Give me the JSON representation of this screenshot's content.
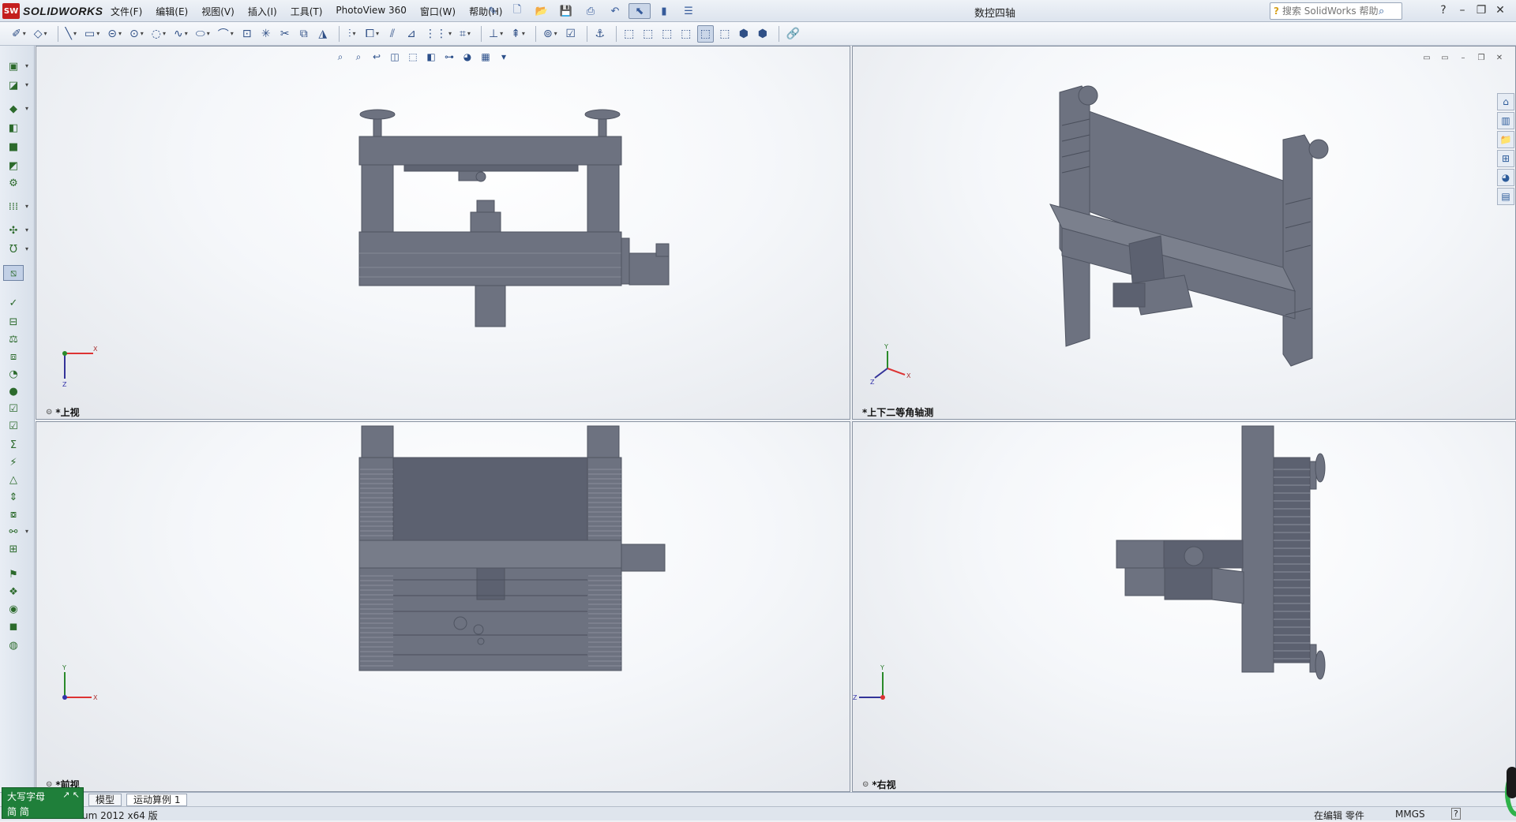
{
  "app": {
    "logo_text": "SOLIDWORKS",
    "logo_badge": "SW",
    "doc_title": "数控四轴"
  },
  "menus": [
    "文件(F)",
    "编辑(E)",
    "视图(V)",
    "插入(I)",
    "工具(T)",
    "PhotoView 360",
    "窗口(W)",
    "帮助(H)"
  ],
  "quick_access": [
    "pin-icon",
    "new-doc-icon",
    "open-icon",
    "save-icon",
    "print-icon",
    "undo-icon",
    "select-icon",
    "rebuild-icon",
    "options-icon"
  ],
  "search": {
    "placeholder": "搜索 SolidWorks 帮助"
  },
  "window_controls": [
    "help-icon",
    "minimize-icon",
    "restore-icon",
    "close-icon"
  ],
  "toolbar": [
    "sketch-icon",
    "smart-dim-icon",
    "line-icon",
    "rectangle-icon",
    "slot-icon",
    "circle-icon",
    "arc-icon",
    "spline-icon",
    "ellipse-icon",
    "fillet-icon",
    "point-icon",
    "centerline-icon",
    "trim-icon",
    "convert-icon",
    "offset-icon",
    "mirror-icon",
    "pattern-icon",
    "move-icon",
    "relations-icon",
    "repair-icon",
    "quick-snap-icon",
    "rapid-sketch-icon",
    "instant3d-icon",
    "normal-to-icon",
    "view-front-icon",
    "view-back-icon",
    "view-left-icon",
    "view-right-icon",
    "view-four-icon",
    "view-top-icon",
    "view-iso-icon",
    "view-bottom-icon",
    "link-icon"
  ],
  "left_tools": [
    "insert-component-icon",
    "mate-icon",
    "linear-pattern-icon",
    "smart-fastener-icon",
    "move-component-icon",
    "show-hidden-icon",
    "assembly-feature-icon",
    "reference-geometry-icon",
    "new-motion-icon",
    "bill-of-materials-icon",
    "exploded-view-icon",
    "spell-check-icon",
    "measure-icon",
    "mass-properties-icon",
    "section-properties-icon",
    "sensor-icon",
    "check-icon",
    "interference-icon",
    "clearance-icon",
    "hole-alignment-icon",
    "sum-icon",
    "simulation-icon",
    "draft-analysis-icon",
    "thickness-icon",
    "symmetry-icon",
    "compare-icon",
    "toolbox-icon",
    "design-check-icon",
    "appearance-icon",
    "render-icon",
    "photoview-icon"
  ],
  "viewports": {
    "top": {
      "label": "*上视"
    },
    "iso": {
      "label": "*上下二等角轴测"
    },
    "front": {
      "label": "*前视"
    },
    "right": {
      "label": "*右视"
    }
  },
  "view_hud": [
    "zoom-fit-icon",
    "zoom-area-icon",
    "previous-view-icon",
    "section-view-icon",
    "view-orientation-icon",
    "display-style-icon",
    "hide-show-icon",
    "appearance-icon",
    "scene-icon",
    "render-tools-icon"
  ],
  "viewport_controls": [
    "split-h-icon",
    "split-v-icon",
    "minimize-icon",
    "restore-icon",
    "close-icon"
  ],
  "task_pane": [
    "home-icon",
    "resources-icon",
    "design-library-icon",
    "file-explorer-icon",
    "appearance-scene-icon",
    "custom-props-icon"
  ],
  "axes": {
    "x": "X",
    "y": "Y",
    "z": "Z"
  },
  "tabs": [
    "模型",
    "运动算例 1"
  ],
  "status": {
    "left": "um 2012 x64 版",
    "editing": "在编辑 零件",
    "units": "MMGS",
    "help": "?"
  },
  "ime": {
    "row1": "大写字母",
    "row2": "简 简",
    "mode": "↗ ↖"
  },
  "colors": {
    "model": "#6d7280",
    "model_dark": "#4f5461",
    "model_light": "#868b98",
    "accent": "#c41e1e"
  }
}
